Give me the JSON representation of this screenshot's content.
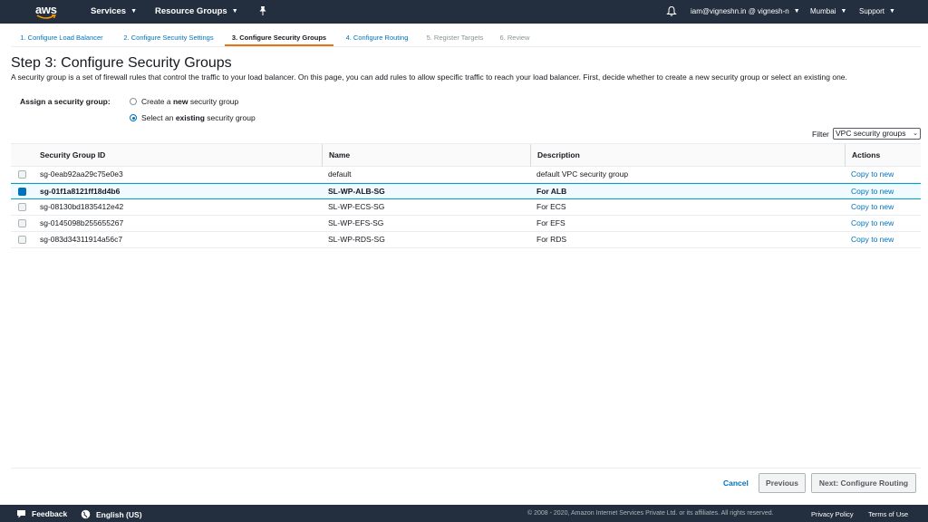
{
  "topnav": {
    "logo": "aws",
    "services": "Services",
    "resource_groups": "Resource Groups",
    "account": "iam@vigneshn.in @ vignesh-n",
    "region": "Mumbai",
    "support": "Support",
    "icons": [
      "pin-icon",
      "bell-icon"
    ]
  },
  "tabs": [
    {
      "label": "1. Configure Load Balancer",
      "state": "done"
    },
    {
      "label": "2. Configure Security Settings",
      "state": "done"
    },
    {
      "label": "3. Configure Security Groups",
      "state": "current"
    },
    {
      "label": "4. Configure Routing",
      "state": "done"
    },
    {
      "label": "5. Register Targets",
      "state": "future"
    },
    {
      "label": "6. Review",
      "state": "future"
    }
  ],
  "page": {
    "title": "Step 3: Configure Security Groups",
    "intro": "A security group is a set of firewall rules that control the traffic to your load balancer. On this page, you can add rules to allow specific traffic to reach your load balancer. First, decide whether to create a new security group or select an existing one."
  },
  "assign": {
    "label": "Assign a security group:",
    "options": [
      {
        "prefix": "Create a ",
        "bold": "new",
        "suffix": " security group",
        "selected": false
      },
      {
        "prefix": "Select an ",
        "bold": "existing",
        "suffix": " security group",
        "selected": true
      }
    ]
  },
  "filter": {
    "label": "Filter",
    "value": "VPC security groups"
  },
  "table": {
    "headers": [
      "Security Group ID",
      "Name",
      "Description",
      "Actions"
    ],
    "rows": [
      {
        "id": "sg-0eab92aa29c75e0e3",
        "name": "default",
        "description": "default VPC security group",
        "action": "Copy to new",
        "selected": false
      },
      {
        "id": "sg-01f1a8121ff18d4b6",
        "name": "SL-WP-ALB-SG",
        "description": "For ALB",
        "action": "Copy to new",
        "selected": true
      },
      {
        "id": "sg-08130bd1835412e42",
        "name": "SL-WP-ECS-SG",
        "description": "For ECS",
        "action": "Copy to new",
        "selected": false
      },
      {
        "id": "sg-0145098b255655267",
        "name": "SL-WP-EFS-SG",
        "description": "For EFS",
        "action": "Copy to new",
        "selected": false
      },
      {
        "id": "sg-083d34311914a56c7",
        "name": "SL-WP-RDS-SG",
        "description": "For RDS",
        "action": "Copy to new",
        "selected": false
      }
    ]
  },
  "buttons": {
    "cancel": "Cancel",
    "previous": "Previous",
    "next": "Next: Configure Routing"
  },
  "bottombar": {
    "feedback": "Feedback",
    "language": "English (US)",
    "copyright": "© 2008 - 2020, Amazon Internet Services Private Ltd. or its affiliates. All rights reserved.",
    "privacy": "Privacy Policy",
    "terms": "Terms of Use"
  },
  "colors": {
    "nav_bg": "#232f3e",
    "link": "#0073bb",
    "active_tab_underline": "#ec7211",
    "selected_row_bg": "#f1faff"
  }
}
